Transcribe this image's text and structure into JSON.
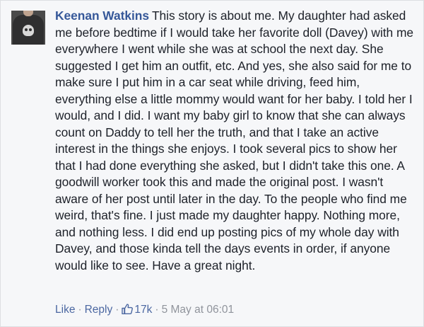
{
  "comment": {
    "author": "Keenan Watkins",
    "text": "This story is about me. My daughter had asked me before bedtime if I would take her favorite doll (Davey) with me everywhere I went while she was at school the next day. She suggested I get him an outfit, etc. And yes, she also said for me to make sure I put him in a car seat while driving, feed him, everything else a little mommy would want for her baby. I told her I would, and I did. I want my baby girl to know that she can always count on Daddy to tell her the truth, and that I take an active interest in the things she enjoys. I took several pics to show her that I had done everything she asked, but I didn't take this one. A goodwill worker took this and made the original post. I wasn't aware of her post until later in the day. To the people who find me weird, that's fine. I just made my daughter happy. Nothing more, and nothing less. I did end up posting pics of my whole day with Davey, and those kinda tell the days events in order, if anyone would like to see. Have a great night."
  },
  "actions": {
    "like_label": "Like",
    "reply_label": "Reply",
    "separator": "·",
    "like_count": "17k",
    "timestamp": "5 May at 06:01",
    "like_icon": "thumbs-up-icon"
  },
  "colors": {
    "author": "#365899",
    "link": "#4b67a1",
    "muted": "#90949c",
    "text": "#1d2129",
    "background": "#f6f7f9"
  }
}
